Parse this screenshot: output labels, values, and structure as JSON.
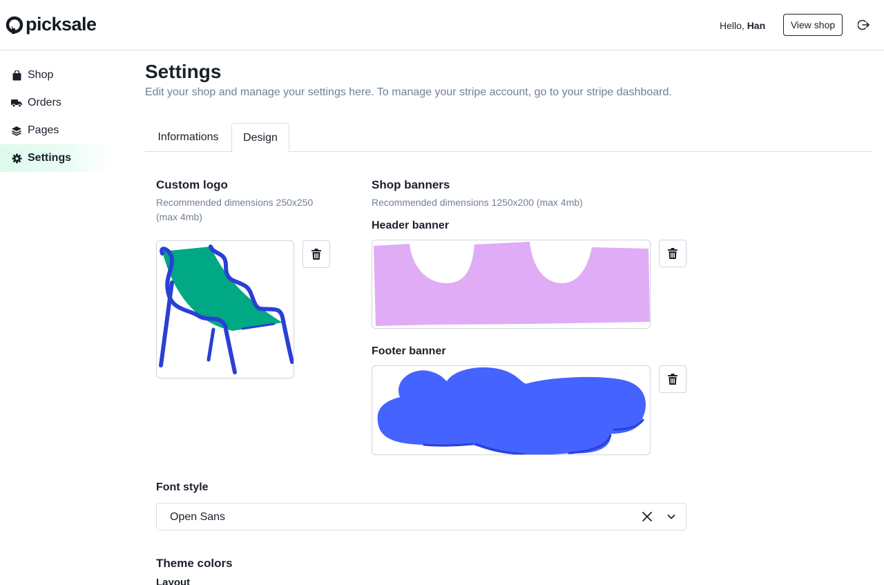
{
  "brand": {
    "name": "picksale"
  },
  "header": {
    "greeting_prefix": "Hello,",
    "user_name": "Han",
    "view_shop_label": "View shop",
    "logout_icon": "logout-icon"
  },
  "sidebar": {
    "items": [
      {
        "label": "Shop",
        "icon": "shopping-bag-icon",
        "active": false
      },
      {
        "label": "Orders",
        "icon": "truck-icon",
        "active": false
      },
      {
        "label": "Pages",
        "icon": "layers-icon",
        "active": false
      },
      {
        "label": "Settings",
        "icon": "gear-icon",
        "active": true
      }
    ]
  },
  "page": {
    "title": "Settings",
    "subtitle": "Edit your shop and manage your settings here. To manage your stripe account, go to your stripe dashboard."
  },
  "tabs": [
    {
      "label": "Informations",
      "active": false
    },
    {
      "label": "Design",
      "active": true
    }
  ],
  "design": {
    "logo": {
      "title": "Custom logo",
      "hint": "Recommended dimensions 250x250 (max 4mb)"
    },
    "banners": {
      "title": "Shop banners",
      "hint": "Recommended dimensions 1250x200 (max 4mb)",
      "header_label": "Header banner",
      "footer_label": "Footer banner"
    },
    "font": {
      "title": "Font style",
      "value": "Open Sans"
    },
    "theme": {
      "title": "Theme colors",
      "layout_label": "Layout"
    }
  },
  "colors": {
    "active_nav_bg": "#dcfbec",
    "logo_green": "#00a884",
    "logo_blue": "#2a3fd6",
    "header_banner": "#e0acf5",
    "footer_banner": "#4563ff",
    "muted_text": "#718096"
  }
}
